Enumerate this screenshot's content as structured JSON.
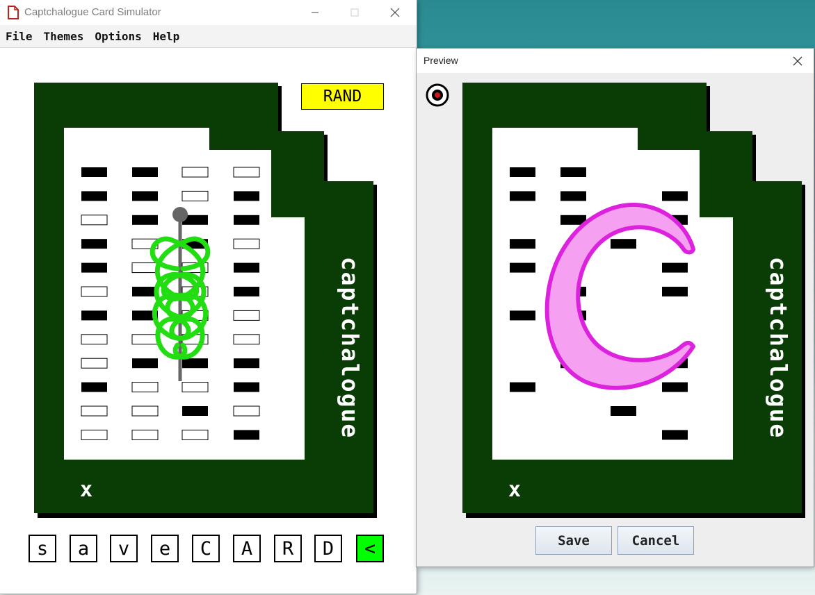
{
  "main_window": {
    "title": "Captchalogue Card Simulator",
    "menu": [
      "File",
      "Themes",
      "Options",
      "Help"
    ],
    "rand_label": "RAND",
    "card_text": "captchalogue",
    "corner_mark": "x",
    "keys": [
      "s",
      "a",
      "v",
      "e",
      "C",
      "A",
      "R",
      "D",
      "<"
    ]
  },
  "preview_window": {
    "title": "Preview",
    "card_text": "captchalogue",
    "corner_mark": "x",
    "save_label": "Save",
    "cancel_label": "Cancel"
  },
  "colors": {
    "card_green": "#0a3d06",
    "rand_bg": "#ffff00",
    "key_active": "#00ff00",
    "snake": "#22dd11",
    "moon": "#dd22dd"
  },
  "icons": [
    "java-app-icon",
    "minimize-icon",
    "maximize-icon",
    "close-icon",
    "close-icon",
    "camera-lens-icon",
    "caduceus-icon",
    "crescent-moon-icon"
  ],
  "punch_grid_main": [
    [
      "F",
      "F",
      "O",
      "O"
    ],
    [
      "F",
      "F",
      "O",
      "F"
    ],
    [
      "O",
      "F",
      "F",
      "F"
    ],
    [
      "F",
      "O",
      "F",
      "O"
    ],
    [
      "F",
      "O",
      "O",
      "F"
    ],
    [
      "O",
      "F",
      "O",
      "F"
    ],
    [
      "F",
      "F",
      "O",
      "O"
    ],
    [
      "O",
      "O",
      "O",
      "O"
    ],
    [
      "O",
      "F",
      "F",
      "F"
    ],
    [
      "F",
      "O",
      "O",
      "F"
    ],
    [
      "O",
      "O",
      "F",
      "O"
    ],
    [
      "O",
      "O",
      "O",
      "F"
    ]
  ],
  "punch_grid_preview": [
    [
      "F",
      "F",
      "",
      ""
    ],
    [
      "F",
      "F",
      "",
      "F"
    ],
    [
      "",
      "F",
      "F",
      "F"
    ],
    [
      "F",
      "",
      "F",
      ""
    ],
    [
      "F",
      "",
      "",
      "F"
    ],
    [
      "",
      "F",
      "",
      "F"
    ],
    [
      "F",
      "F",
      "",
      ""
    ],
    [
      "",
      "",
      "",
      ""
    ],
    [
      "",
      "F",
      "F",
      "F"
    ],
    [
      "F",
      "",
      "",
      "F"
    ],
    [
      "",
      "",
      "F",
      ""
    ],
    [
      "",
      "",
      "",
      "F"
    ]
  ]
}
